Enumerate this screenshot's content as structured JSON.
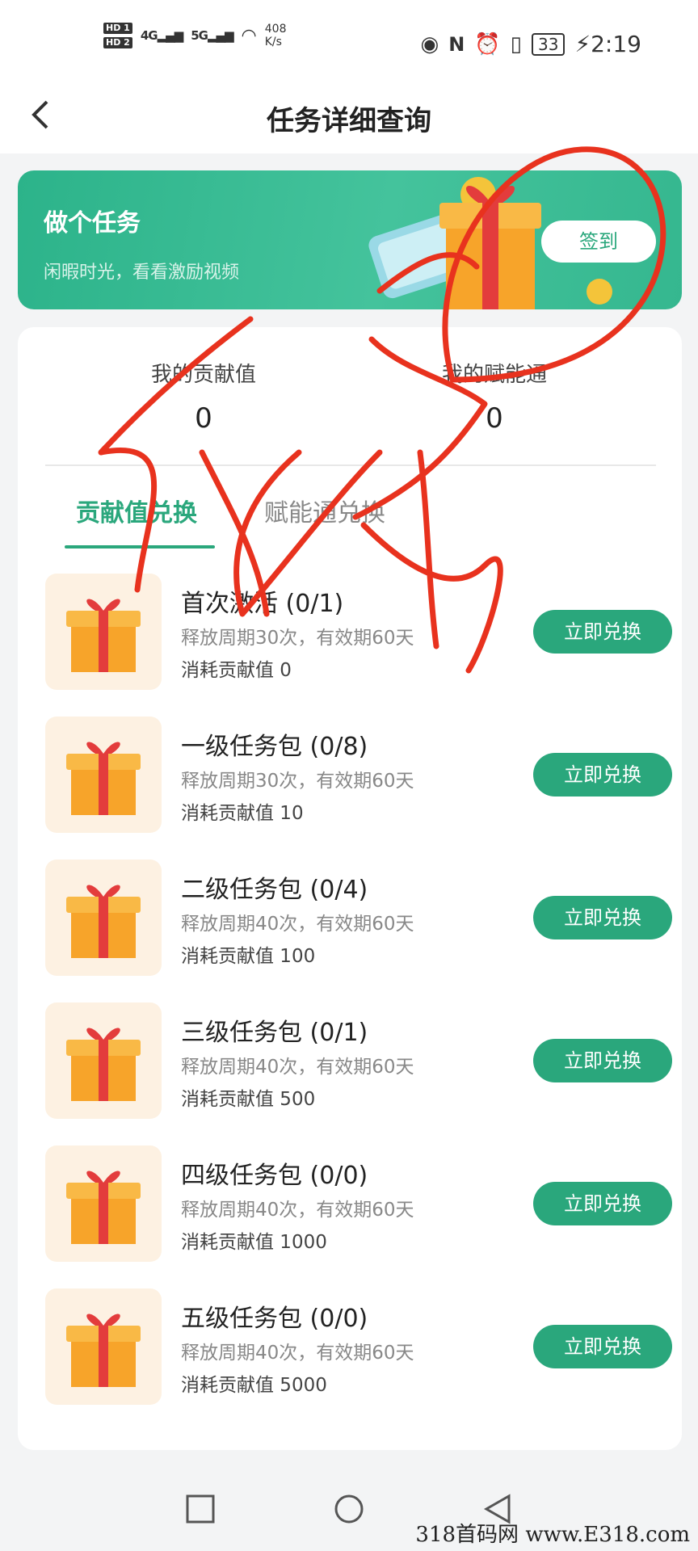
{
  "status_bar": {
    "hd1": "HD 1",
    "hd2": "HD 2",
    "signal1": "4G",
    "signal2": "5G",
    "net_speed": "408",
    "net_unit": "K/s",
    "battery": "33",
    "time": "2:19"
  },
  "header": {
    "back_label": "<",
    "title": "任务详细查询"
  },
  "banner": {
    "title": "做个任务",
    "subtitle": "闲暇时光，看看激励视频",
    "signin_label": "签到"
  },
  "stats": {
    "contribution_label": "我的贡献值",
    "contribution_value": "0",
    "enabling_label": "我的赋能通",
    "enabling_value": "0"
  },
  "tabs": [
    "贡献值兑换",
    "赋能通兑换"
  ],
  "items": [
    {
      "name": "首次激活",
      "count": "(0/1)",
      "release": "释放周期30次，有效期60天",
      "cost": "消耗贡献值 0",
      "button": "立即兑换"
    },
    {
      "name": "一级任务包",
      "count": "(0/8)",
      "release": "释放周期30次，有效期60天",
      "cost": "消耗贡献值 10",
      "button": "立即兑换"
    },
    {
      "name": "二级任务包",
      "count": "(0/4)",
      "release": "释放周期40次，有效期60天",
      "cost": "消耗贡献值 100",
      "button": "立即兑换"
    },
    {
      "name": "三级任务包",
      "count": "(0/1)",
      "release": "释放周期40次，有效期60天",
      "cost": "消耗贡献值 500",
      "button": "立即兑换"
    },
    {
      "name": "四级任务包",
      "count": "(0/0)",
      "release": "释放周期40次，有效期60天",
      "cost": "消耗贡献值 1000",
      "button": "立即兑换"
    },
    {
      "name": "五级任务包",
      "count": "(0/0)",
      "release": "释放周期40次，有效期60天",
      "cost": "消耗贡献值 5000",
      "button": "立即兑换"
    }
  ],
  "watermark": "318首码网 www.E318.com",
  "colors": {
    "accent": "#2aa77c",
    "annotation": "#e8321e",
    "gift": "#f7a42a"
  }
}
